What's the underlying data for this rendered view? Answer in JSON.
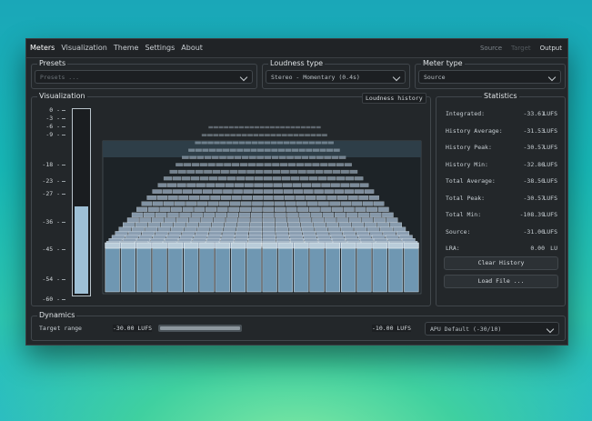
{
  "menu": {
    "items": [
      "Meters",
      "Visualization",
      "Theme",
      "Settings",
      "About"
    ],
    "active": 0,
    "right": [
      "Source",
      "Target",
      "Output"
    ]
  },
  "presets": {
    "title": "Presets",
    "placeholder": "Presets ..."
  },
  "loudness_type": {
    "title": "Loudness type",
    "value": "Stereo - Momentary (0.4s)"
  },
  "meter_type": {
    "title": "Meter type",
    "value": "Source"
  },
  "visualization": {
    "title": "Visualization",
    "history_label": "Loudness history",
    "scale": [
      "0 -",
      "-3 -",
      "-6 -",
      "-9 -",
      "-18 -",
      "-23 -",
      "-27 -",
      "-36 -",
      "-45 -",
      "-54 -",
      "-60 -"
    ],
    "meter_level": 0.47
  },
  "statistics": {
    "title": "Statistics",
    "rows": [
      {
        "label": "Integrated:",
        "value": "-33.61",
        "unit": "LUFS"
      },
      {
        "label": "History Average:",
        "value": "-31.53",
        "unit": "LUFS"
      },
      {
        "label": "History Peak:",
        "value": "-30.57",
        "unit": "LUFS"
      },
      {
        "label": "History Min:",
        "value": "-32.86",
        "unit": "LUFS"
      },
      {
        "label": "Total Average:",
        "value": "-38.50",
        "unit": "LUFS"
      },
      {
        "label": "Total Peak:",
        "value": "-30.57",
        "unit": "LUFS"
      },
      {
        "label": "Total Min:",
        "value": "-108.39",
        "unit": "LUFS"
      },
      {
        "label": "Source:",
        "value": "-31.00",
        "unit": "LUFS"
      },
      {
        "label": "LRA:",
        "value": "0.00",
        "unit": "LU"
      }
    ],
    "clear_label": "Clear History",
    "load_label": "Load File ..."
  },
  "dynamics": {
    "title": "Dynamics",
    "target_range_label": "Target range",
    "min_value": "-30.00 LUFS",
    "max_value": "-10.00 LUFS",
    "preset": "APU Default (-30/10)"
  },
  "colors": {
    "accent": "#8fb4cc",
    "bar": "#6f97b2",
    "panel": "#23272a"
  }
}
